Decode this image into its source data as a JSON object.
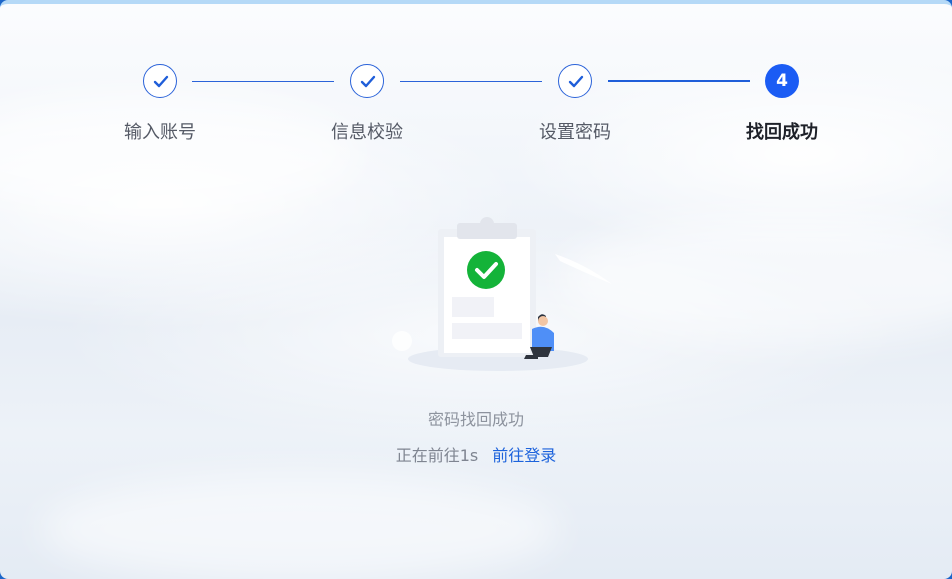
{
  "steps": [
    {
      "label": "输入账号",
      "state": "done",
      "icon": "check-icon"
    },
    {
      "label": "信息校验",
      "state": "done",
      "icon": "check-icon"
    },
    {
      "label": "设置密码",
      "state": "done",
      "icon": "check-icon"
    },
    {
      "label": "找回成功",
      "state": "active",
      "number": "4"
    }
  ],
  "result": {
    "message": "密码找回成功",
    "countdown_text": "正在前往1s",
    "login_link": "前往登录"
  },
  "colors": {
    "accent": "#1b5cf4",
    "success": "#14b339",
    "link": "#1d63dc"
  },
  "illustration": {
    "icon": "success-check-icon",
    "person_shirt_color": "#4f8ff7"
  }
}
